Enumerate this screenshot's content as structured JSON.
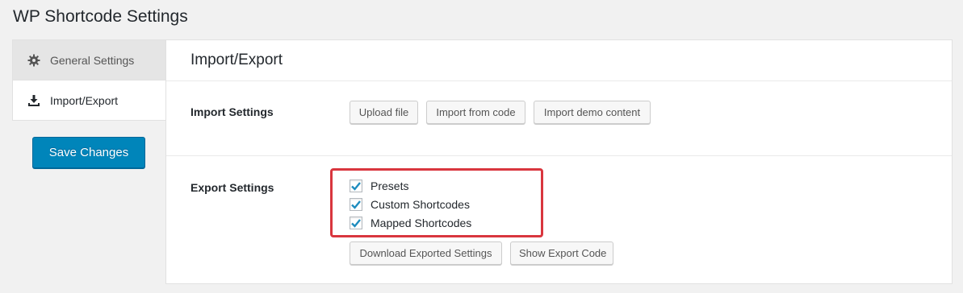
{
  "page": {
    "title": "WP Shortcode Settings"
  },
  "sidebar": {
    "items": [
      {
        "label": "General Settings",
        "icon": "gear-icon"
      },
      {
        "label": "Import/Export",
        "icon": "download-icon"
      }
    ],
    "save_label": "Save Changes"
  },
  "panel": {
    "title": "Import/Export",
    "import": {
      "label": "Import Settings",
      "buttons": [
        "Upload file",
        "Import from code",
        "Import demo content"
      ]
    },
    "export": {
      "label": "Export Settings",
      "options": [
        {
          "label": "Presets",
          "checked": true
        },
        {
          "label": "Custom Shortcodes",
          "checked": true
        },
        {
          "label": "Mapped Shortcodes",
          "checked": true
        }
      ],
      "buttons": [
        "Download Exported Settings",
        "Show Export Code"
      ]
    }
  },
  "colors": {
    "primary": "#0085ba",
    "highlight": "#d9363e",
    "check": "#1e8cbe"
  }
}
